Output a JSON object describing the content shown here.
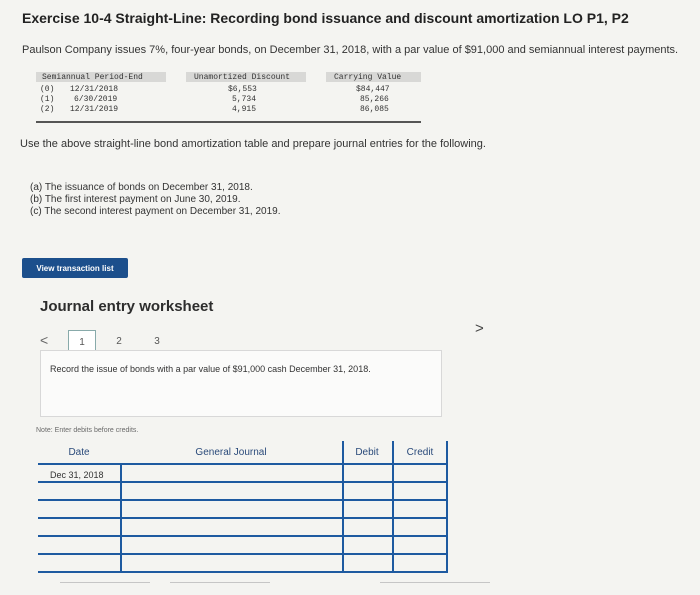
{
  "exercise": {
    "title": "Exercise 10-4 Straight-Line: Recording bond issuance and discount amortization LO P1, P2",
    "intro": "Paulson Company issues 7%, four-year bonds, on December 31, 2018, with a par value of $91,000 and semiannual interest payments."
  },
  "amortization_table": {
    "headers": [
      "Semiannual Period-End",
      "Unamortized Discount",
      "Carrying Value"
    ],
    "rows": [
      {
        "period": "(0)",
        "date": "12/31/2018",
        "discount": "$6,553",
        "carrying": "$84,447"
      },
      {
        "period": "(1)",
        "date": "6/30/2019",
        "discount": "5,734",
        "carrying": "85,266"
      },
      {
        "period": "(2)",
        "date": "12/31/2019",
        "discount": "4,915",
        "carrying": "86,085"
      }
    ]
  },
  "instructions": "Use the above straight-line bond amortization table and prepare journal entries for the following.",
  "parts": [
    "(a) The issuance of bonds on December 31, 2018.",
    "(b) The first interest payment on June 30, 2019.",
    "(c) The second interest payment on December 31, 2019."
  ],
  "view_button": "View transaction list",
  "worksheet": {
    "title": "Journal entry worksheet",
    "nav_prev": "<",
    "nav_next": ">",
    "tabs": [
      "1",
      "2",
      "3"
    ],
    "prompt": "Record the issue of bonds with a par value of $91,000 cash December 31, 2018.",
    "note": "Note: Enter debits before credits.",
    "columns": {
      "date": "Date",
      "journal": "General Journal",
      "debit": "Debit",
      "credit": "Credit"
    },
    "first_date": "Dec 31, 2018"
  }
}
